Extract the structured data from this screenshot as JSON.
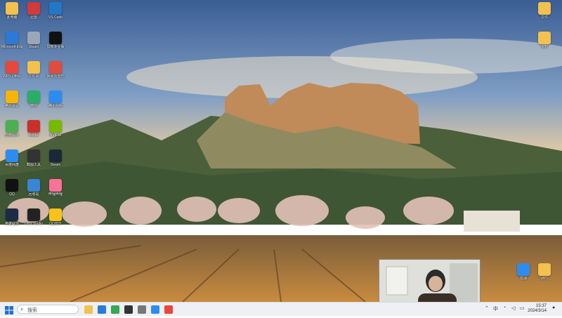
{
  "desktop": {
    "icons": [
      {
        "label": "此电脑",
        "icon": "folder-icon",
        "color": "#f2c14e"
      },
      {
        "label": "Microsoft Edge",
        "icon": "edge-icon",
        "color": "#2b7bd6"
      },
      {
        "label": "WPS Office",
        "icon": "wps-icon",
        "color": "#e8473b"
      },
      {
        "label": "腾讯会议",
        "icon": "meeting-icon",
        "color": "#f7b500"
      },
      {
        "label": "应用程序",
        "icon": "app-icon",
        "color": "#4caf50"
      },
      {
        "label": "百度网盘",
        "icon": "baidu-icon",
        "color": "#2d8cf0"
      },
      {
        "label": "QQ",
        "icon": "qq-icon",
        "color": "#111111"
      },
      {
        "label": "英雄联盟",
        "icon": "lol-icon",
        "color": "#1d2b44"
      },
      {
        "label": "迅雷",
        "icon": "xunlei-icon",
        "color": "#d23b3b"
      },
      {
        "label": "Steam",
        "icon": "steam-icon",
        "color": "#9aa7b8"
      },
      {
        "label": "文件夹",
        "icon": "folder-icon",
        "color": "#f2c14e"
      },
      {
        "label": "微信",
        "icon": "wechat-icon",
        "color": "#2aae67"
      },
      {
        "label": "Adobe",
        "icon": "adobe-icon",
        "color": "#c9302c"
      },
      {
        "label": "截图工具",
        "icon": "tool-icon",
        "color": "#333333"
      },
      {
        "label": "回收站",
        "icon": "recycle-icon",
        "color": "#3a86d4"
      },
      {
        "label": "OBS Studio",
        "icon": "obs-icon",
        "color": "#222222"
      },
      {
        "label": "VS Code",
        "icon": "code-icon",
        "color": "#2477c4"
      },
      {
        "label": "剪映专业版",
        "icon": "video-icon",
        "color": "#111111"
      },
      {
        "label": "网易云音乐",
        "icon": "music-icon",
        "color": "#e24c3c"
      },
      {
        "label": "腾讯视频",
        "icon": "tv-icon",
        "color": "#2d8cf0"
      },
      {
        "label": "NVIDIA",
        "icon": "nvidia-icon",
        "color": "#76b900"
      },
      {
        "label": "Steam",
        "icon": "steam-icon",
        "color": "#1b2838"
      },
      {
        "label": "哔哩哔哩",
        "icon": "bili-icon",
        "color": "#fb7299"
      },
      {
        "label": "QQ音乐",
        "icon": "qqmusic-icon",
        "color": "#f8c21a"
      }
    ],
    "right_icons": [
      {
        "label": "文件",
        "icon": "folder-icon",
        "color": "#f2c14e"
      },
      {
        "label": "资料",
        "icon": "folder-icon",
        "color": "#f2c14e"
      },
      {
        "label": "蓝湖",
        "icon": "app-icon",
        "color": "#2d8cf0"
      },
      {
        "label": "WPS",
        "icon": "wps-icon",
        "color": "#f2c14e"
      }
    ]
  },
  "taskbar": {
    "start_icon": "windows-start-icon",
    "search_placeholder": "搜索",
    "pinned": [
      "file-explorer-icon",
      "edge-icon",
      "chrome-icon",
      "terminal-icon",
      "settings-icon",
      "store-icon",
      "app-icon"
    ],
    "tray_text": "中",
    "time": "15:37",
    "date": "2024/3/14"
  }
}
